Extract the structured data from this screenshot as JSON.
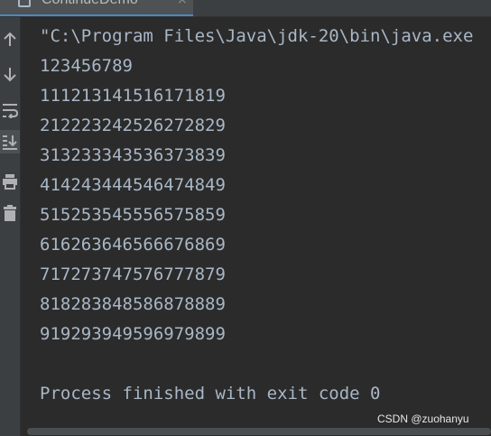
{
  "tab": {
    "label": "ContinueDemo",
    "icon": "console-tab-icon",
    "close_glyph": "×"
  },
  "toolbar": {
    "buttons": [
      {
        "name": "scroll-up-icon"
      },
      {
        "name": "scroll-down-icon"
      },
      {
        "name": "soft-wrap-icon"
      },
      {
        "name": "scroll-to-end-icon",
        "active": true
      },
      {
        "name": "print-icon"
      },
      {
        "name": "clear-all-icon"
      }
    ]
  },
  "console": {
    "lines": [
      "\"C:\\Program Files\\Java\\jdk-20\\bin\\java.exe",
      "123456789",
      "111213141516171819",
      "212223242526272829",
      "313233343536373839",
      "414243444546474849",
      "515253545556575859",
      "616263646566676869",
      "717273747576777879",
      "818283848586878889",
      "919293949596979899",
      "",
      "Process finished with exit code 0"
    ]
  },
  "watermark": "CSDN @zuohanyu",
  "colors": {
    "background": "#2b2b2b",
    "text": "#a9b7c6",
    "toolbar": "#3c3f41",
    "icon": "#afb1b3"
  }
}
